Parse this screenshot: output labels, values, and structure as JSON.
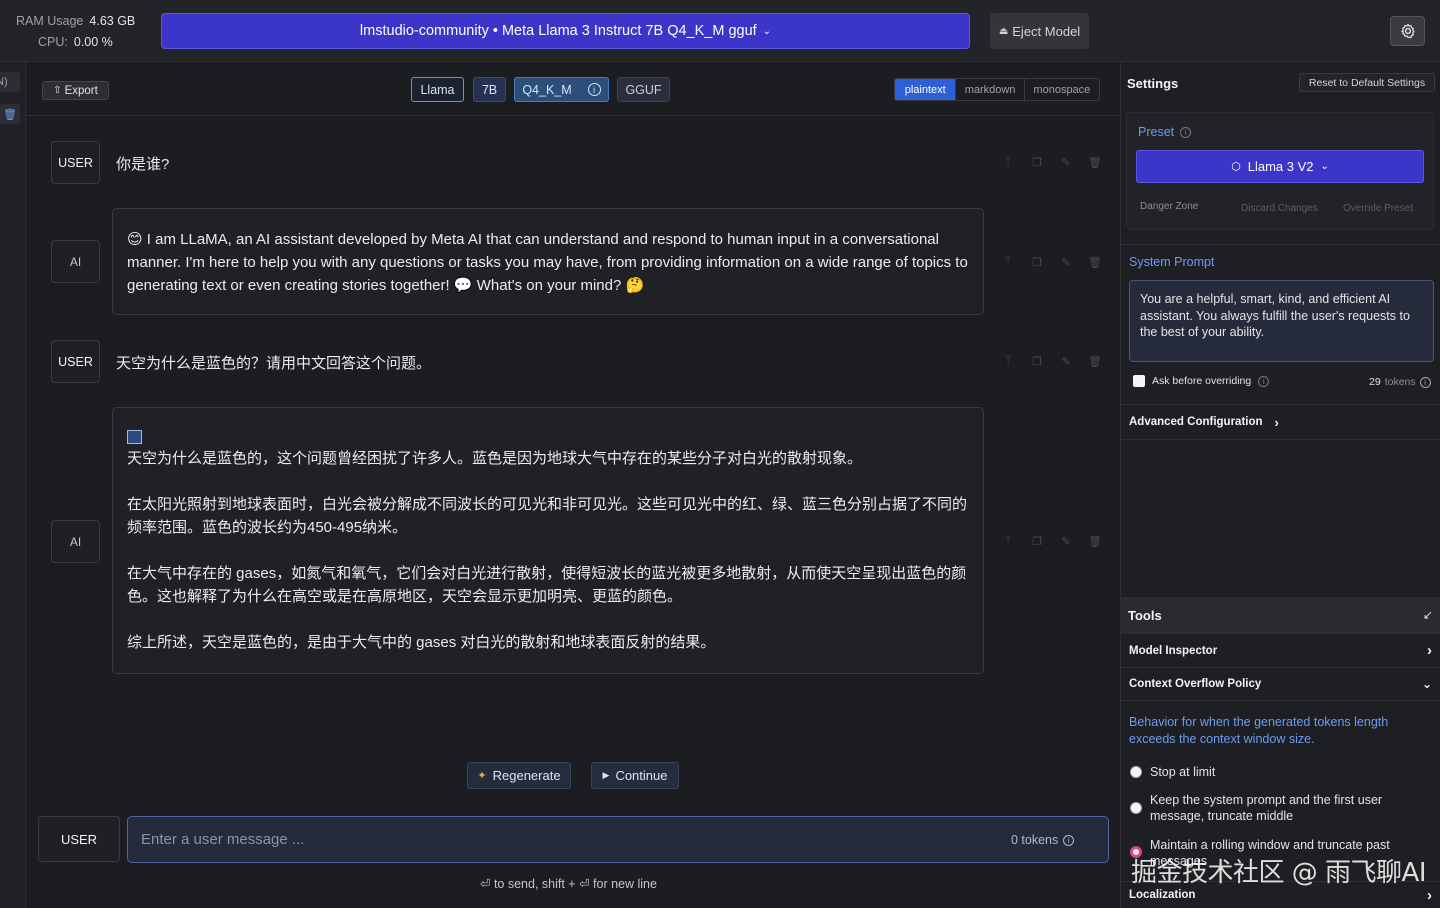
{
  "topbar": {
    "ram_label": "RAM Usage",
    "ram_value": "4.63 GB",
    "cpu_label": "CPU:",
    "cpu_value": "0.00 %",
    "model_name": "lmstudio-community • Meta Llama 3 Instruct 7B Q4_K_M gguf",
    "eject_label": "Eject Model"
  },
  "leftstrip": {
    "partial_text": "N)"
  },
  "chat_header": {
    "export_label": "Export",
    "tags": [
      "Llama",
      "7B",
      "Q4_K_M",
      "GGUF"
    ],
    "formats": [
      "plaintext",
      "markdown",
      "monospace"
    ],
    "active_format": "plaintext"
  },
  "messages": [
    {
      "role": "USER",
      "text": "你是谁?"
    },
    {
      "role": "AI",
      "paragraphs": [
        "😊 I am LLaMA, an AI assistant developed by Meta AI that can understand and respond to human input in a conversational manner. I'm here to help you with any questions or tasks you may have, from providing information on a wide range of topics to generating text or even creating stories together! 💬 What's on your mind? 🤔"
      ]
    },
    {
      "role": "USER",
      "text": "天空为什么是蓝色的？请用中文回答这个问题。"
    },
    {
      "role": "AI",
      "paragraphs": [
        "天空为什么是蓝色的，这个问题曾经困扰了许多人。蓝色是因为地球大气中存在的某些分子对白光的散射现象。",
        "在太阳光照射到地球表面时，白光会被分解成不同波长的可见光和非可见光。这些可见光中的红、绿、蓝三色分别占据了不同的频率范围。蓝色的波长约为450-495纳米。",
        "在大气中存在的 gases，如氮气和氧气，它们会对白光进行散射，使得短波长的蓝光被更多地散射，从而使天空呈现出蓝色的颜色。这也解释了为什么在高空或是在高原地区，天空会显示更加明亮、更蓝的颜色。",
        "综上所述，天空是蓝色的，是由于大气中的 gases 对白光的散射和地球表面反射的结果。"
      ]
    }
  ],
  "actions": {
    "regenerate": "Regenerate",
    "continue": "Continue"
  },
  "composer": {
    "role": "USER",
    "placeholder": "Enter a user message ...",
    "value": "",
    "tokens": "0 tokens",
    "hint": "⏎ to send, shift + ⏎ for new line"
  },
  "settings": {
    "title": "Settings",
    "reset_label": "Reset to Default Settings",
    "preset_label": "Preset",
    "preset_value": "Llama 3 V2",
    "danger_zone": "Danger Zone",
    "discard_changes": "Discard Changes",
    "override_preset": "Override Preset",
    "system_prompt_label": "System Prompt",
    "system_prompt": "You are a helpful, smart, kind, and efficient AI assistant. You always fulfill the user's requests to the best of your ability.",
    "ask_before_overriding": "Ask before overriding",
    "ask_before_overriding_checked": false,
    "token_count": "29",
    "token_word": "tokens",
    "advanced_config": "Advanced Configuration",
    "tools_title": "Tools",
    "model_inspector": "Model Inspector",
    "context_overflow": "Context Overflow Policy",
    "overflow_desc": "Behavior for when the generated tokens length exceeds the context window size.",
    "overflow_options": [
      "Stop at limit",
      "Keep the system prompt and the first user message, truncate middle",
      "Maintain a rolling window and truncate past messages"
    ],
    "localization": "Localization"
  },
  "watermark": "掘金技术社区 @ 雨飞聊AI",
  "colors": {
    "accent": "#3b36c9",
    "active_format": "#2f5fd6",
    "link": "#6b9bf2",
    "selected_radio": "#e0457b"
  }
}
